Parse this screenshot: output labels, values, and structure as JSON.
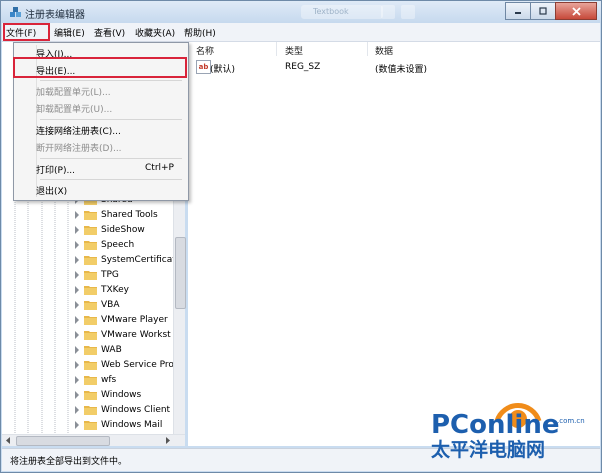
{
  "window": {
    "title": "注册表编辑器",
    "ghost_tab": "Textbook",
    "status_text": "将注册表全部导出到文件中。"
  },
  "menubar": {
    "items": [
      "文件(F)",
      "编辑(E)",
      "查看(V)",
      "收藏夹(A)",
      "帮助(H)"
    ]
  },
  "file_menu": {
    "items": [
      {
        "label": "导入(I)...",
        "enabled": true
      },
      {
        "label": "导出(E)...",
        "enabled": true
      },
      {
        "label": "加载配置单元(L)...",
        "enabled": false
      },
      {
        "label": "卸载配置单元(U)...",
        "enabled": false
      },
      {
        "label": "连接网络注册表(C)...",
        "enabled": true
      },
      {
        "label": "断开网络注册表(D)...",
        "enabled": false
      },
      {
        "label": "打印(P)...",
        "enabled": true,
        "shortcut": "Ctrl+P"
      },
      {
        "label": "退出(X)",
        "enabled": true
      }
    ]
  },
  "values_pane": {
    "columns": [
      "名称",
      "类型",
      "数据"
    ],
    "rows": [
      {
        "name": "(默认)",
        "type": "REG_SZ",
        "data": "(数值未设置)"
      }
    ]
  },
  "tree": {
    "items": [
      "Shared",
      "Shared Tools",
      "SideShow",
      "Speech",
      "SystemCertificate",
      "TPG",
      "TXKey",
      "VBA",
      "VMware Player",
      "VMware Workst",
      "WAB",
      "Web Service Pro",
      "wfs",
      "Windows",
      "Windows Client",
      "Windows Mail"
    ]
  },
  "watermark": {
    "brand": "PConline",
    "domain": ".com.cn",
    "cn_name": "太平洋电脑网"
  },
  "colors": {
    "highlight_box": "#d9243a",
    "folder": "#e8b84a"
  }
}
